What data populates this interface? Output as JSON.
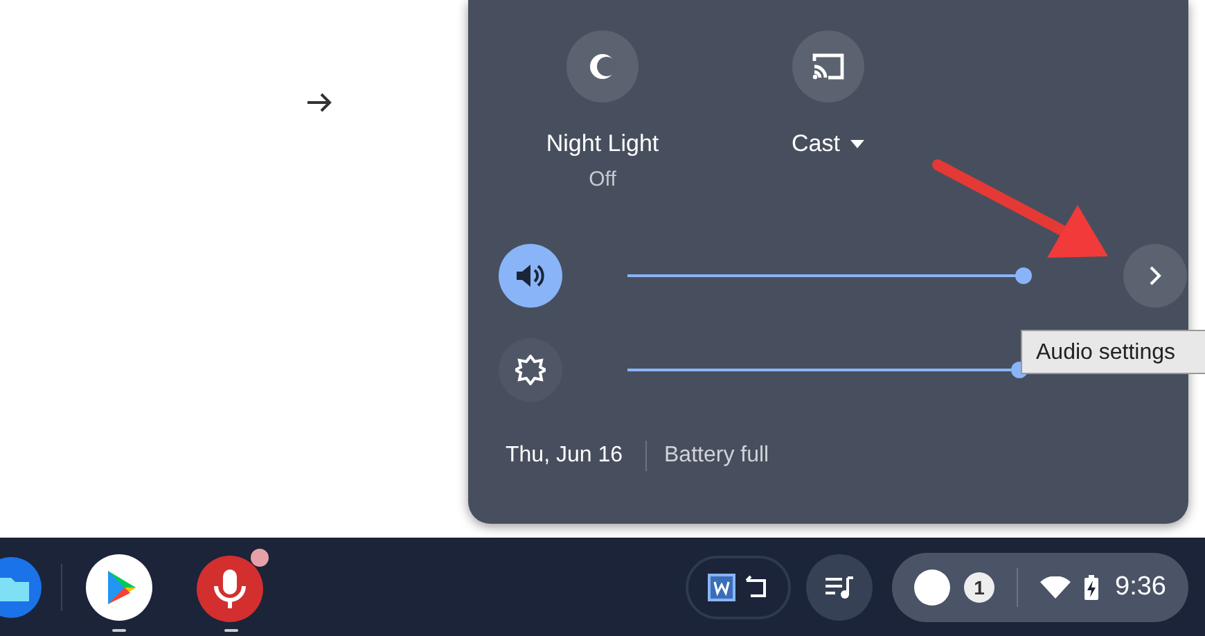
{
  "quick_settings": {
    "tiles": [
      {
        "kind": "night-light",
        "label": "Night Light",
        "sublabel": "Off",
        "on": false
      },
      {
        "kind": "cast",
        "label": "Cast",
        "dropdown": true,
        "on": false
      }
    ],
    "sliders": [
      {
        "kind": "volume",
        "level": 0.8,
        "active": true
      },
      {
        "kind": "brightness",
        "level": 0.79,
        "active": false
      }
    ],
    "tooltip": "Audio settings",
    "date": "Thu, Jun 16",
    "battery": "Battery full"
  },
  "shelf": {
    "apps": [
      {
        "kind": "files",
        "running": false,
        "notification": false
      },
      {
        "kind": "play",
        "running": true,
        "notification": false
      },
      {
        "kind": "mic",
        "running": true,
        "notification": true
      }
    ],
    "notification_count": "1",
    "time": "9:36"
  }
}
